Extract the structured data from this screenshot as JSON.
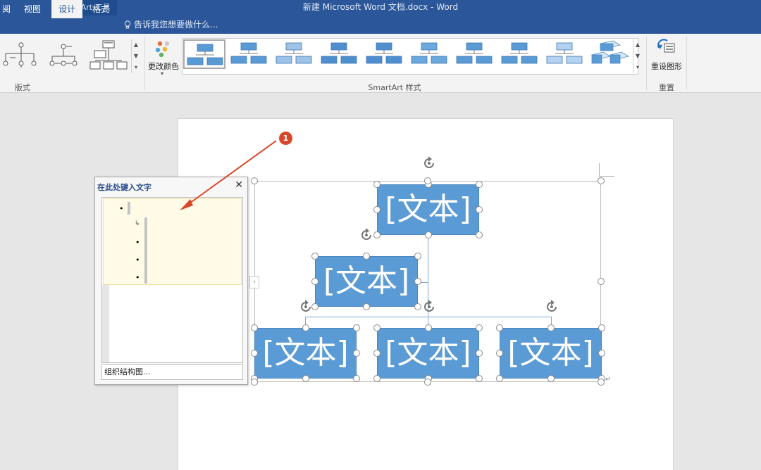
{
  "window": {
    "title": "新建 Microsoft Word 文档.docx - Word",
    "tool_tab_header": "SmartArt 工具"
  },
  "tabs": [
    {
      "label": "阅"
    },
    {
      "label": "视图"
    },
    {
      "label": "设计",
      "active": true
    },
    {
      "label": "格式"
    }
  ],
  "tell_me": {
    "text": "告诉我您想要做什么..."
  },
  "ribbon": {
    "groups": {
      "layouts": "版式",
      "styles": "SmartArt 样式",
      "reset": "重置"
    },
    "change_colors_label": "更改颜色",
    "reset_graphic_label": "重设图形"
  },
  "text_pane": {
    "title": "在此处键入文字",
    "close_glyph": "✕",
    "footer": "组织结构图..."
  },
  "smartart": {
    "top": "[文本]",
    "assistant": "[文本]",
    "children": [
      "[文本]",
      "[文本]",
      "[文本]"
    ]
  },
  "annotation": {
    "badge": "1"
  },
  "colors": {
    "title_bar": "#2b579a",
    "ribbon": "#f3f3f3",
    "shape_fill": "#5b9bd5",
    "badge": "#d9472b"
  }
}
